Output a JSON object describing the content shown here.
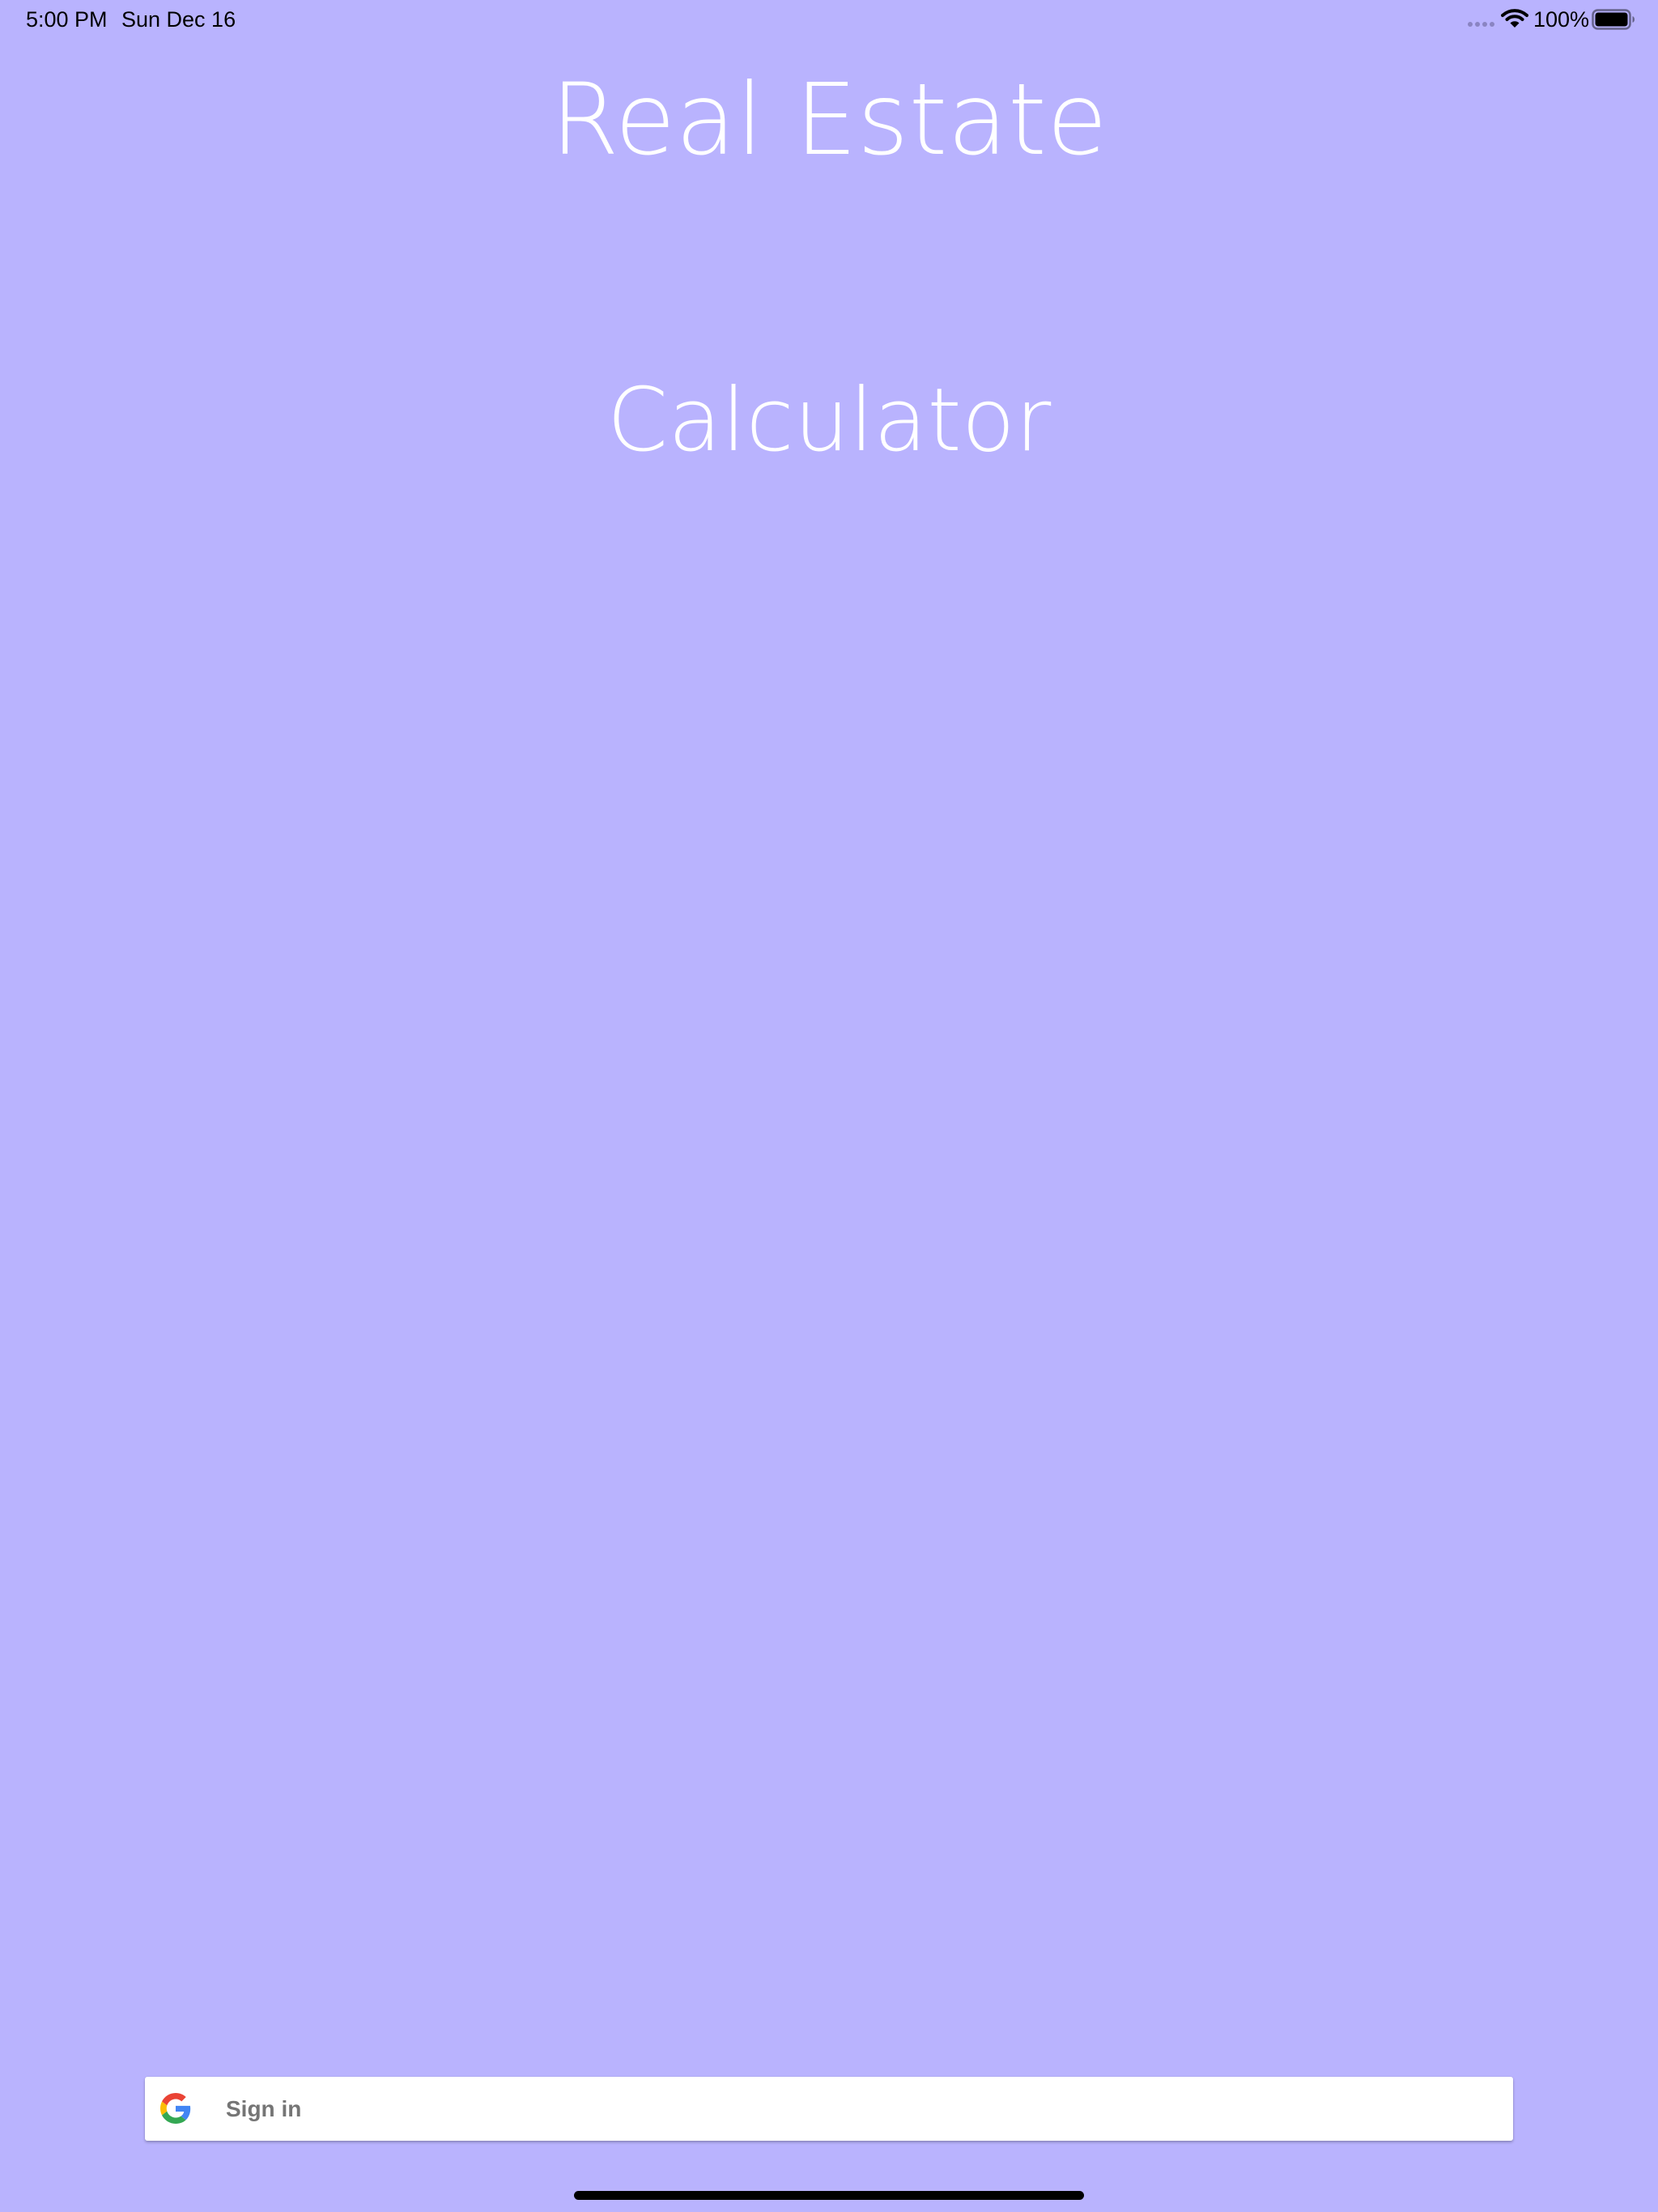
{
  "status_bar": {
    "time": "5:00 PM",
    "date": "Sun Dec 16",
    "battery_percent": "100%",
    "battery_level": 1.0,
    "icons": [
      "signal-dots-icon",
      "wifi-icon",
      "battery-icon"
    ]
  },
  "title": {
    "line1": "Real Estate",
    "line2": "Calculator"
  },
  "signin": {
    "label": "Sign in",
    "icon": "google-icon"
  },
  "colors": {
    "background": "#b9b3fe",
    "title_text": "#ffffff",
    "button_background": "#ffffff",
    "button_text": "#757575"
  }
}
